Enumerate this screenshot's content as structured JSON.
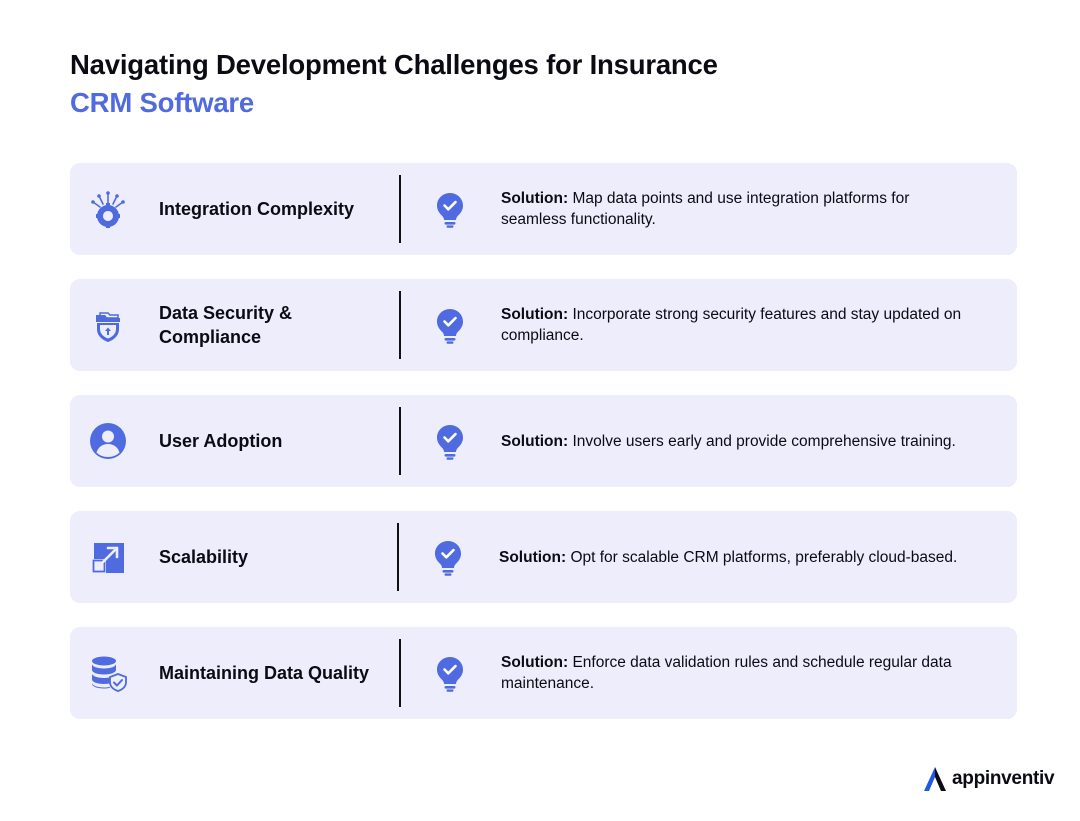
{
  "title": {
    "line1": "Navigating Development Challenges for Insurance",
    "line2": "CRM Software"
  },
  "colors": {
    "accent": "#4f6bdf",
    "card_bg": "#ededfb",
    "text": "#0b0b14"
  },
  "cards": [
    {
      "icon": "integration-gear-icon",
      "label": "Integration Complexity",
      "solution_prefix": "Solution:",
      "solution_text": " Map data points and use integration platforms for seamless functionality."
    },
    {
      "icon": "shield-folder-icon",
      "label": "Data Security & Compliance",
      "solution_prefix": "Solution:",
      "solution_text": " Incorporate strong security features and stay updated on compliance."
    },
    {
      "icon": "user-icon",
      "label": "User Adoption",
      "solution_prefix": "Solution:",
      "solution_text": " Involve users early and provide comprehensive training."
    },
    {
      "icon": "expand-arrow-icon",
      "label": "Scalability",
      "solution_prefix": "Solution:",
      "solution_text": " Opt for scalable CRM platforms, preferably cloud-based."
    },
    {
      "icon": "database-check-icon",
      "label": "Maintaining Data Quality",
      "solution_prefix": "Solution:",
      "solution_text": " Enforce data validation rules and schedule regular data maintenance."
    }
  ],
  "brand": {
    "name": "appinventiv",
    "icon": "appinventiv-logo-icon"
  }
}
